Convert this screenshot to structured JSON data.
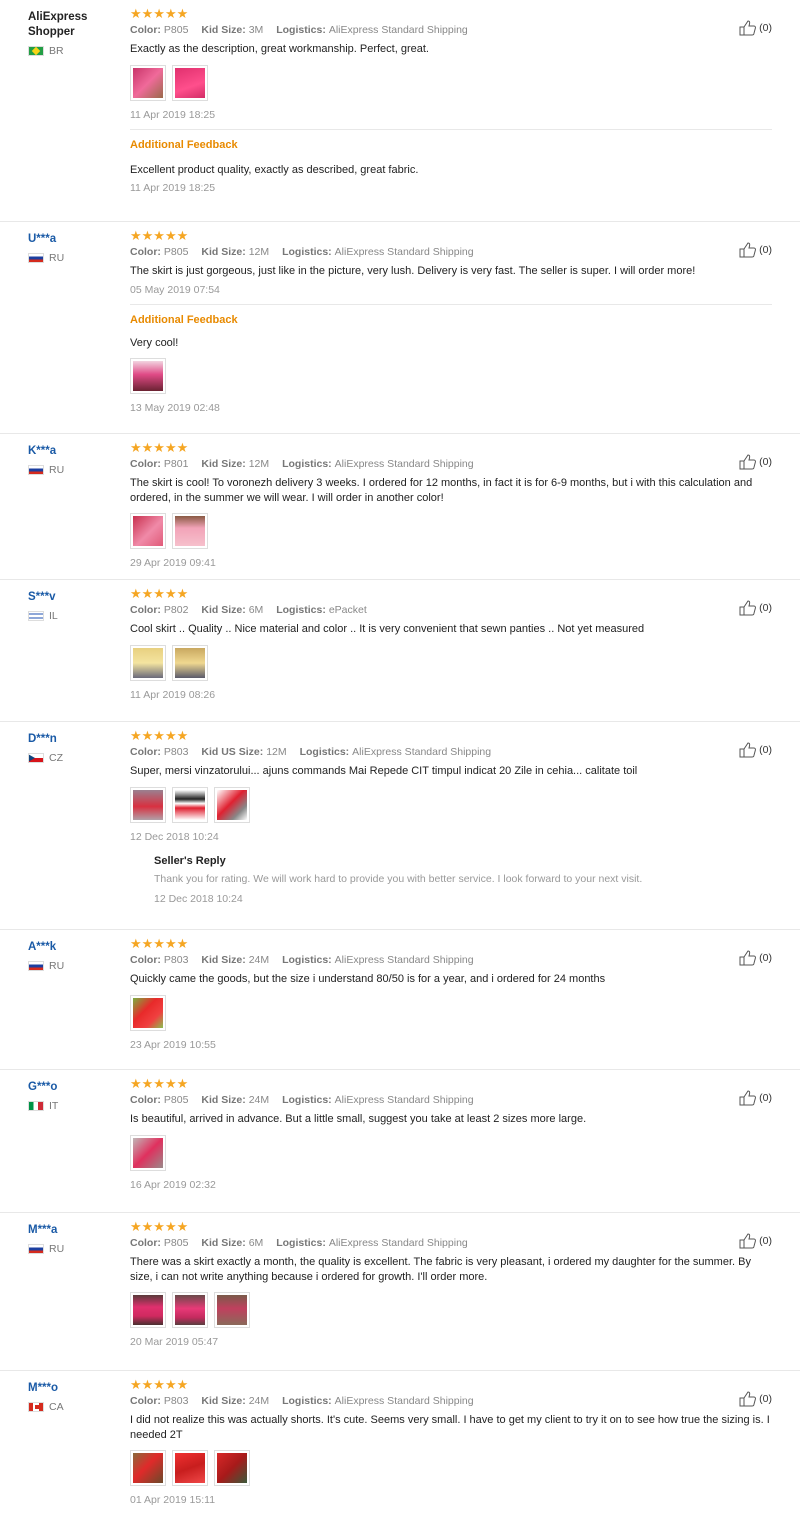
{
  "labels": {
    "color": "Color:",
    "kid_size": "Kid Size:",
    "kid_us_size": "Kid US Size:",
    "logistics": "Logistics:",
    "additional_feedback": "Additional Feedback",
    "sellers_reply": "Seller's Reply"
  },
  "colors": {
    "star": "#f5a623",
    "username": "#1a5aa6",
    "feedback_title": "#e88a00"
  },
  "reviews": [
    {
      "user": "AliExpress Shopper",
      "country": "BR",
      "stars": "★★★★★",
      "color": "P805",
      "size": "3M",
      "logistics": "AliExpress Standard Shipping",
      "text": "Exactly as the description, great workmanship. Perfect, great.",
      "photos": 2,
      "date": "11 Apr 2019 18:25",
      "helpful": "(0)",
      "feedback_text": "Excellent product quality, exactly as described, great fabric.",
      "feedback_date": "11 Apr 2019 18:25"
    },
    {
      "user": "U***a",
      "country": "RU",
      "stars": "★★★★★",
      "color": "P805",
      "size": "12M",
      "logistics": "AliExpress Standard Shipping",
      "text": "The skirt is just gorgeous, just like in the picture, very lush. Delivery is very fast. The seller is super. I will order more!",
      "date": "05 May 2019 07:54",
      "helpful": "(0)",
      "feedback_text": "Very cool!",
      "feedback_date": "13 May 2019 02:48"
    },
    {
      "user": "K***a",
      "country": "RU",
      "stars": "★★★★★",
      "color": "P801",
      "size": "12M",
      "logistics": "AliExpress Standard Shipping",
      "text": "The skirt is cool! To voronezh delivery 3 weeks. I ordered for 12 months, in fact it is for 6-9 months, but i with this calculation and ordered, in the summer we will wear. I will order in another color!",
      "photos": 2,
      "date": "29 Apr 2019 09:41",
      "helpful": "(0)"
    },
    {
      "user": "S***v",
      "country": "IL",
      "stars": "★★★★★",
      "color": "P802",
      "size": "6M",
      "logistics": "ePacket",
      "text": "Cool skirt .. Quality .. Nice material and color .. It is very convenient that sewn panties .. Not yet measured",
      "photos": 2,
      "date": "11 Apr 2019 08:26",
      "helpful": "(0)"
    },
    {
      "user": "D***n",
      "country": "CZ",
      "stars": "★★★★★",
      "color": "P803",
      "size": "12M",
      "logistics": "AliExpress Standard Shipping",
      "text": "Super, mersi vinzatorului... ajuns commands Mai Repede CIT timpul indicat 20 Zile in cehia... calitate toil",
      "photos": 3,
      "date": "12 Dec 2018 10:24",
      "helpful": "(0)",
      "reply_text": "Thank you for rating. We will work hard to provide you with better service. I look forward to your next visit.",
      "reply_date": "12 Dec 2018 10:24"
    },
    {
      "user": "A***k",
      "country": "RU",
      "stars": "★★★★★",
      "color": "P803",
      "size": "24M",
      "logistics": "AliExpress Standard Shipping",
      "text": "Quickly came the goods, but the size i understand 80/50 is for a year, and i ordered for 24 months",
      "photos": 1,
      "date": "23 Apr 2019 10:55",
      "helpful": "(0)"
    },
    {
      "user": "G***o",
      "country": "IT",
      "stars": "★★★★★",
      "color": "P805",
      "size": "24M",
      "logistics": "AliExpress Standard Shipping",
      "text": "Is beautiful, arrived in advance. But a little small, suggest you take at least 2 sizes more large.",
      "photos": 1,
      "date": "16 Apr 2019 02:32",
      "helpful": "(0)"
    },
    {
      "user": "M***a",
      "country": "RU",
      "stars": "★★★★★",
      "color": "P805",
      "size": "6M",
      "logistics": "AliExpress Standard Shipping",
      "text": "There was a skirt exactly a month, the quality is excellent. The fabric is very pleasant, i ordered my daughter for the summer. By size, i can not write anything because i ordered for growth. I'll order more.",
      "photos": 3,
      "date": "20 Mar 2019 05:47",
      "helpful": "(0)"
    },
    {
      "user": "M***o",
      "country": "CA",
      "stars": "★★★★★",
      "color": "P803",
      "size": "24M",
      "logistics": "AliExpress Standard Shipping",
      "text": "I did not realize this was actually shorts. It's cute. Seems very small. I have to get my client to try it on to see how true the sizing is. I needed 2T",
      "photos": 3,
      "date": "01 Apr 2019 15:11",
      "helpful": "(0)"
    }
  ]
}
